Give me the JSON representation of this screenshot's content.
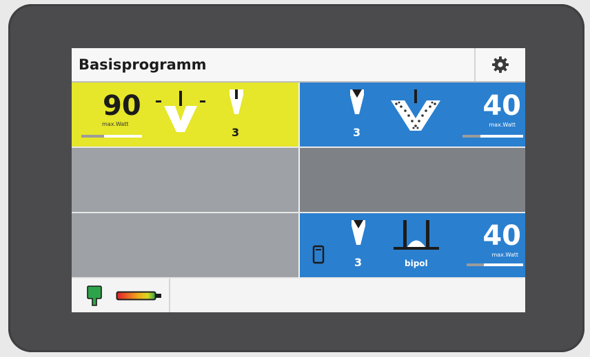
{
  "header": {
    "title": "Basisprogramm",
    "settings_icon": "gear-icon"
  },
  "channels": {
    "left_top": {
      "power_value": "90",
      "power_unit": "max.Watt",
      "power_level": 0.62,
      "mode_number": "3",
      "color": "#e6e62a",
      "icons": [
        "cut-v-icon",
        "electrode-tip-icon"
      ]
    },
    "right_top": {
      "power_value": "40",
      "power_unit": "max.Watt",
      "power_level": 0.3,
      "mode_number": "3",
      "color": "#2a7fcf",
      "icons": [
        "electrode-tip-icon",
        "coag-v-icon"
      ]
    },
    "right_bottom": {
      "power_value": "40",
      "power_unit": "max.Watt",
      "power_level": 0.3,
      "mode_number": "3",
      "mode_label": "bipol",
      "color": "#2a7fcf",
      "icons": [
        "device-icon",
        "electrode-tip-icon",
        "bipolar-forceps-icon"
      ]
    }
  },
  "footer": {
    "icons": [
      "neutral-electrode-icon",
      "contact-quality-bar-icon"
    ]
  }
}
